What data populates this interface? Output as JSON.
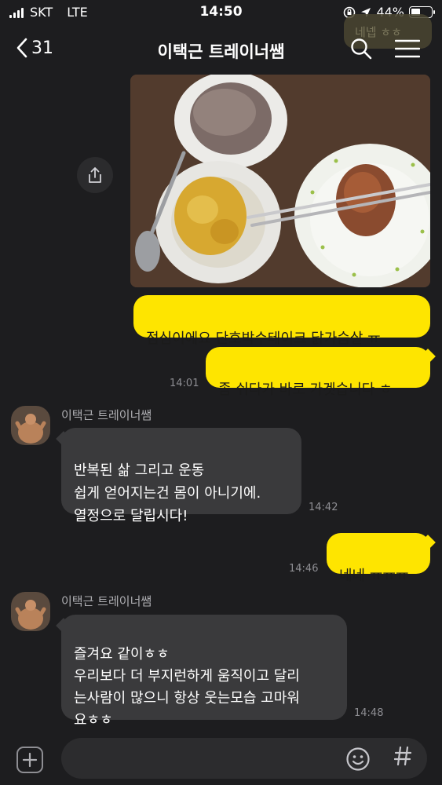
{
  "status_bar": {
    "carrier": "SKT",
    "network": "LTE",
    "time": "14:50",
    "battery_percent": "44%",
    "battery_level": 0.44
  },
  "nav": {
    "back_count": "31",
    "title": "이택근 트레이너쌤",
    "icons": [
      "chevron-left-icon",
      "search-icon",
      "menu-icon"
    ]
  },
  "ghost_bubble": "네넵 ㅎㅎ",
  "messages": {
    "m1": {
      "text": "점심이에요 단호박수테이크 닭가슴살 ㅠ"
    },
    "m2": {
      "text": "좀 쉬다가 바로 가겟습니다 ㅎ",
      "time": "14:01"
    },
    "m3": {
      "sender": "이택근 트레이너쌤",
      "text": "반복된 삶 그리고 운동\n쉽게 얻어지는건 몸이 아니기에.\n열정으로 달립시다!",
      "time": "14:42"
    },
    "m4": {
      "text": "네네 ㅠㅠㅠ",
      "time": "14:46"
    },
    "m5": {
      "sender": "이택근 트레이너쌤",
      "text": "즐겨요 같이ㅎㅎ\n우리보다 더 부지런하게 움직이고 달리\n는사람이 많으니 항상 웃는모습 고마워\n요ㅎㅎ",
      "time": "14:48"
    }
  },
  "input": {
    "placeholder": "",
    "icons": [
      "plus-icon",
      "emoji-icon",
      "hash-icon"
    ]
  },
  "colors": {
    "background": "#1d1d1f",
    "my_bubble": "#fee500",
    "other_bubble": "#3a3a3c",
    "timestamp": "#8e8e93"
  }
}
